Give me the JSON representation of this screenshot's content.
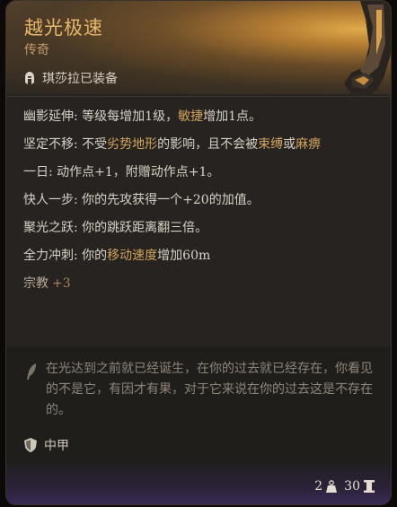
{
  "item": {
    "name": "越光极速",
    "rarity": "传奇",
    "equipped_label": "琪莎拉已装备"
  },
  "properties": [
    {
      "name": "幽影延伸:",
      "parts": [
        "等级每增加1级，",
        "敏捷",
        "增加1点。"
      ]
    },
    {
      "name": "坚定不移:",
      "parts": [
        "不受",
        "劣势地形",
        "的影响，且不会被",
        "束缚",
        "或",
        "麻痹"
      ]
    },
    {
      "name": "一日:",
      "text": "动作点+1，附赠动作点+1。"
    },
    {
      "name": "快人一步:",
      "text": "你的先攻获得一个+20的加值。"
    },
    {
      "name": "聚光之跃:",
      "text": "你的跳跃距离翻三倍。"
    },
    {
      "name": "全力冲刺:",
      "parts": [
        "你的",
        "移动速度",
        "增加60m"
      ]
    }
  ],
  "religion": {
    "label": "宗教",
    "value": "+3"
  },
  "lore": "在光达到之前就已经诞生，在你的过去就已经存在，你看见的不是它，有因才有果，对于它来说在你的过去这是不存在的。",
  "armor_type": "中甲",
  "footer": {
    "weight": "2",
    "price": "30"
  },
  "icons": {
    "equipped": "helmet-icon",
    "lore": "quill-icon",
    "armor": "shield-icon",
    "weight": "weight-icon",
    "price": "coin-icon"
  },
  "colors": {
    "title": "#e8b66a",
    "highlight": "#d2a35c",
    "lore": "#8e8478"
  }
}
